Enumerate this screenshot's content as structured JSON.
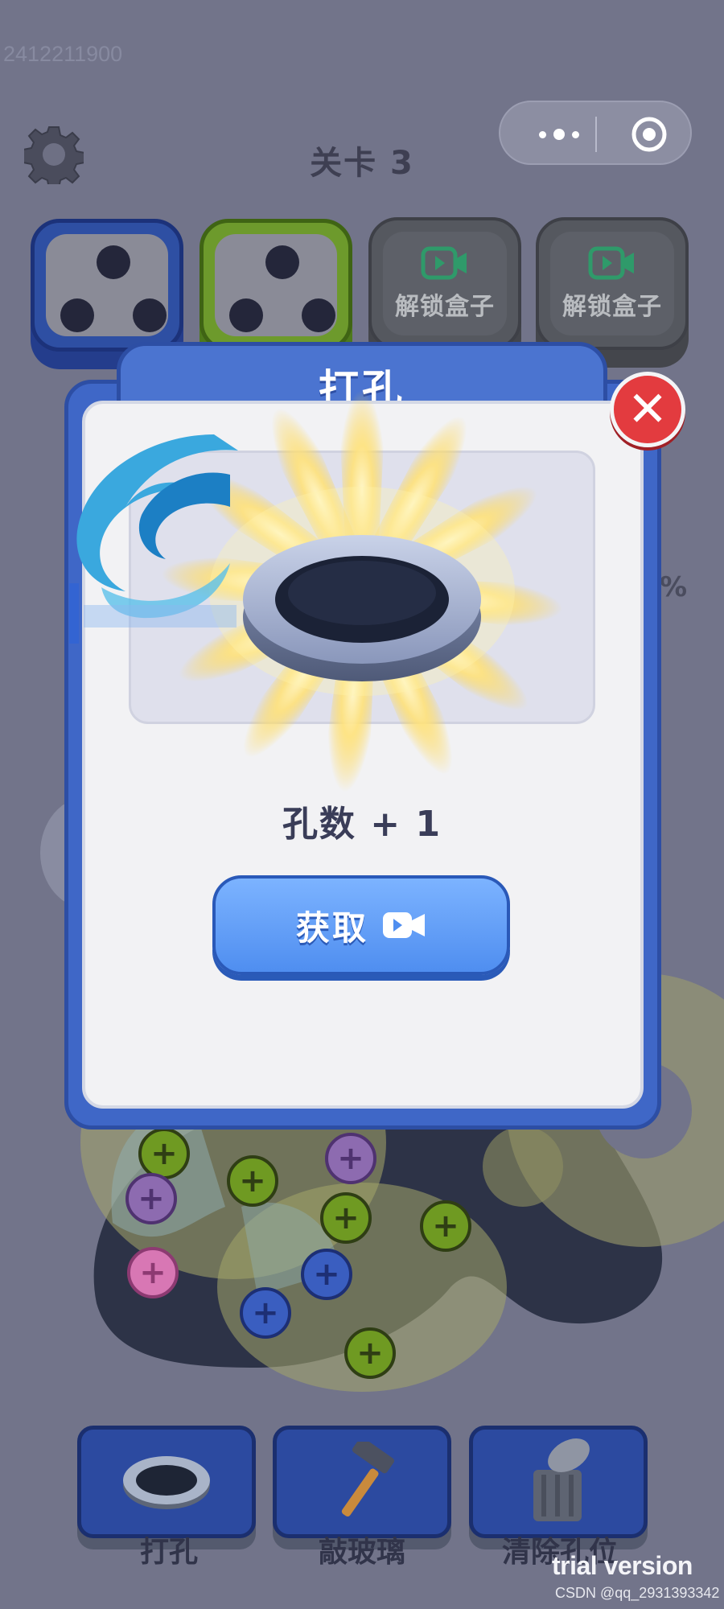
{
  "status": {
    "id_text": "2412211900"
  },
  "header": {
    "level_title": "关卡 3"
  },
  "boxes": [
    {
      "color": "blue",
      "holes": 3
    },
    {
      "color": "green",
      "holes": 3
    },
    {
      "label": "解锁盒子",
      "locked": true
    },
    {
      "label": "解锁盒子",
      "locked": true
    }
  ],
  "modal": {
    "title": "打孔",
    "reward_text": "孔数 + 1",
    "get_button_label": "获取",
    "close_icon": "close-icon",
    "item_icon": "hole-ring-icon"
  },
  "background": {
    "progress_fragment": "%"
  },
  "tools": [
    {
      "label": "打孔",
      "icon": "hole-ring-icon"
    },
    {
      "label": "敲玻璃",
      "icon": "hammer-icon"
    },
    {
      "label": "清除孔位",
      "icon": "trash-can-icon"
    }
  ],
  "watermarks": {
    "trial": "trial version",
    "csdn": "CSDN @qq_2931393342"
  },
  "colors": {
    "background": "#72748a",
    "modal_blue": "#3f67c7",
    "button_blue": "#5b9af4",
    "close_red": "#e33b3f",
    "screw_green": "#6f9a22"
  }
}
